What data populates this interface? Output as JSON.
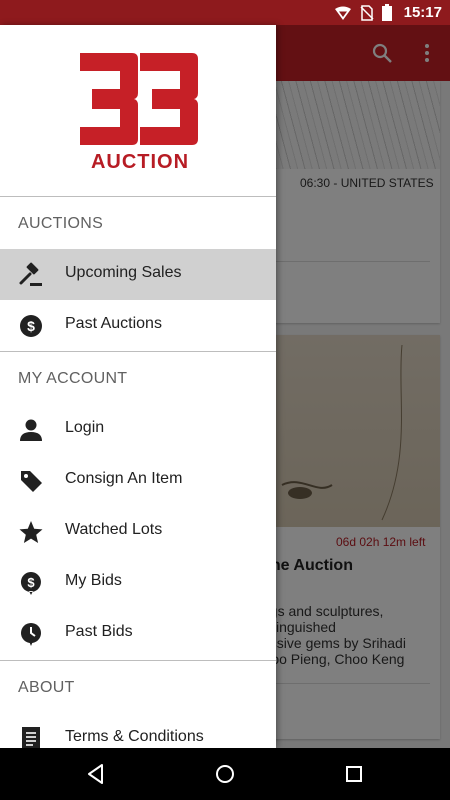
{
  "status_bar": {
    "time": "15:17",
    "icons": [
      "signal-icon",
      "no-sim-icon",
      "battery-icon"
    ]
  },
  "background": {
    "toolbar_icons": [
      "search-icon",
      "overflow-menu-icon"
    ],
    "card1": {
      "meta": "06:30 - UNITED STATES"
    },
    "card2": {
      "time_left": "06d 02h 12m left",
      "title_fragment": "line Auction",
      "desc_lines": [
        "ngs and sculptures,",
        "istinguished",
        "essive gems by Srihadi",
        "Soo Pieng, Choo Keng"
      ]
    }
  },
  "drawer": {
    "logo": {
      "numerals": "33",
      "word": "AUCTION"
    },
    "sections": {
      "auctions": "AUCTIONS",
      "my_account": "MY ACCOUNT",
      "about": "ABOUT"
    },
    "items": {
      "upcoming_sales": "Upcoming Sales",
      "past_auctions": "Past Auctions",
      "login": "Login",
      "consign": "Consign An Item",
      "watched_lots": "Watched Lots",
      "my_bids": "My Bids",
      "past_bids": "Past Bids",
      "terms": "Terms & Conditions"
    }
  },
  "colors": {
    "brand": "#c62027",
    "status_bar": "#8e1a1d",
    "active_item": "#d0d0d0",
    "countdown": "#b71c24"
  }
}
